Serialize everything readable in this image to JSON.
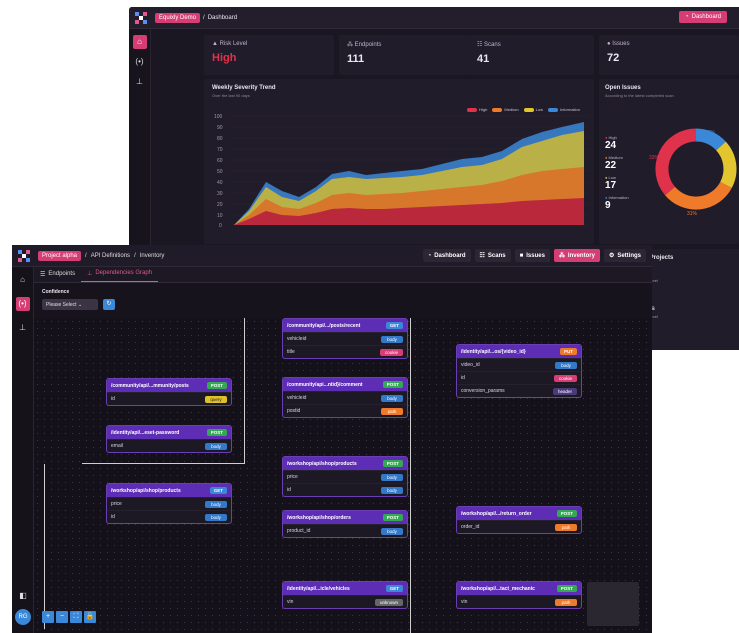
{
  "back": {
    "brand": "Equixly Demo",
    "crumb": "Dashboard",
    "dashboard_button": "Dashboard",
    "stats": [
      {
        "label": "Risk Level",
        "value": "High",
        "color": "#e0324b"
      },
      {
        "label": "Endpoints",
        "value": "111",
        "color": "#ffffff"
      },
      {
        "label": "Scans",
        "value": "41",
        "color": "#ffffff"
      },
      {
        "label": "Issues",
        "value": "72",
        "color": "#ffffff"
      }
    ],
    "trend": {
      "title": "Weekly Severity Trend",
      "subtitle": "Over the last 90 days",
      "legend": [
        "High",
        "Medium",
        "Low",
        "Information"
      ]
    },
    "open_issues": {
      "title": "Open Issues",
      "subtitle": "According to the latest completed scan",
      "rows": [
        {
          "label": "High",
          "count": "24",
          "color": "#e0324b"
        },
        {
          "label": "Medium",
          "count": "22",
          "color": "#ef7a2a"
        },
        {
          "label": "Low",
          "count": "17",
          "color": "#e3c52f"
        },
        {
          "label": "Information",
          "count": "9",
          "color": "#3b87d8"
        }
      ],
      "donut_labels": [
        "13%",
        "33%",
        "31%"
      ]
    },
    "recent_title": "le Projects",
    "recent_items": [
      {
        "sub": "n Level"
      },
      {
        "title": "leta",
        "sub": "n Level"
      }
    ]
  },
  "front": {
    "project_pill": "Project alpha",
    "crumb1": "API Definitions",
    "crumb2": "Inventory",
    "nav": [
      "Dashboard",
      "Scans",
      "Issues",
      "Inventory",
      "Settings"
    ],
    "tabs": [
      "Endpoints",
      "Dependencies Graph"
    ],
    "confidence_label": "Confidence",
    "select_placeholder": "Please Select",
    "avatar": "RG",
    "nodes": [
      {
        "title": "/community/api/...mmunity/posts",
        "method": "POST",
        "rows": [
          [
            "id",
            "query"
          ]
        ]
      },
      {
        "title": "/identity/api/...eset-password",
        "method": "POST",
        "rows": [
          [
            "email",
            "body"
          ]
        ]
      },
      {
        "title": "/workshop/api/shop/products",
        "method": "GET",
        "rows": [
          [
            "price",
            "body"
          ],
          [
            "id",
            "body"
          ]
        ]
      },
      {
        "title": "/community/api/.../posts/recent",
        "method": "GET",
        "rows": [
          [
            "vehicleid",
            "body"
          ],
          [
            "title",
            "cookie"
          ]
        ]
      },
      {
        "title": "/community/api...ntid}/comment",
        "method": "POST",
        "rows": [
          [
            "vehicleid",
            "body"
          ],
          [
            "postid",
            "path"
          ]
        ]
      },
      {
        "title": "/workshop/api/shop/products",
        "method": "POST",
        "rows": [
          [
            "price",
            "body"
          ],
          [
            "id",
            "body"
          ]
        ]
      },
      {
        "title": "/workshop/api/shop/orders",
        "method": "POST",
        "rows": [
          [
            "product_id",
            "body"
          ]
        ]
      },
      {
        "title": "/identity/api/...icle/vehicles",
        "method": "GET",
        "rows": [
          [
            "vin",
            "unknown"
          ]
        ]
      },
      {
        "title": "/identity/api/...os/{video_id}",
        "method": "PUT",
        "rows": [
          [
            "video_id",
            "body"
          ],
          [
            "id",
            "cookie"
          ],
          [
            "conversion_params",
            "header"
          ]
        ]
      },
      {
        "title": "/workshop/api/.../return_order",
        "method": "POST",
        "rows": [
          [
            "order_id",
            "path"
          ]
        ]
      },
      {
        "title": "/workshop/api/...tact_mechanic",
        "method": "POST",
        "rows": [
          [
            "vin",
            "path"
          ]
        ]
      }
    ]
  }
}
